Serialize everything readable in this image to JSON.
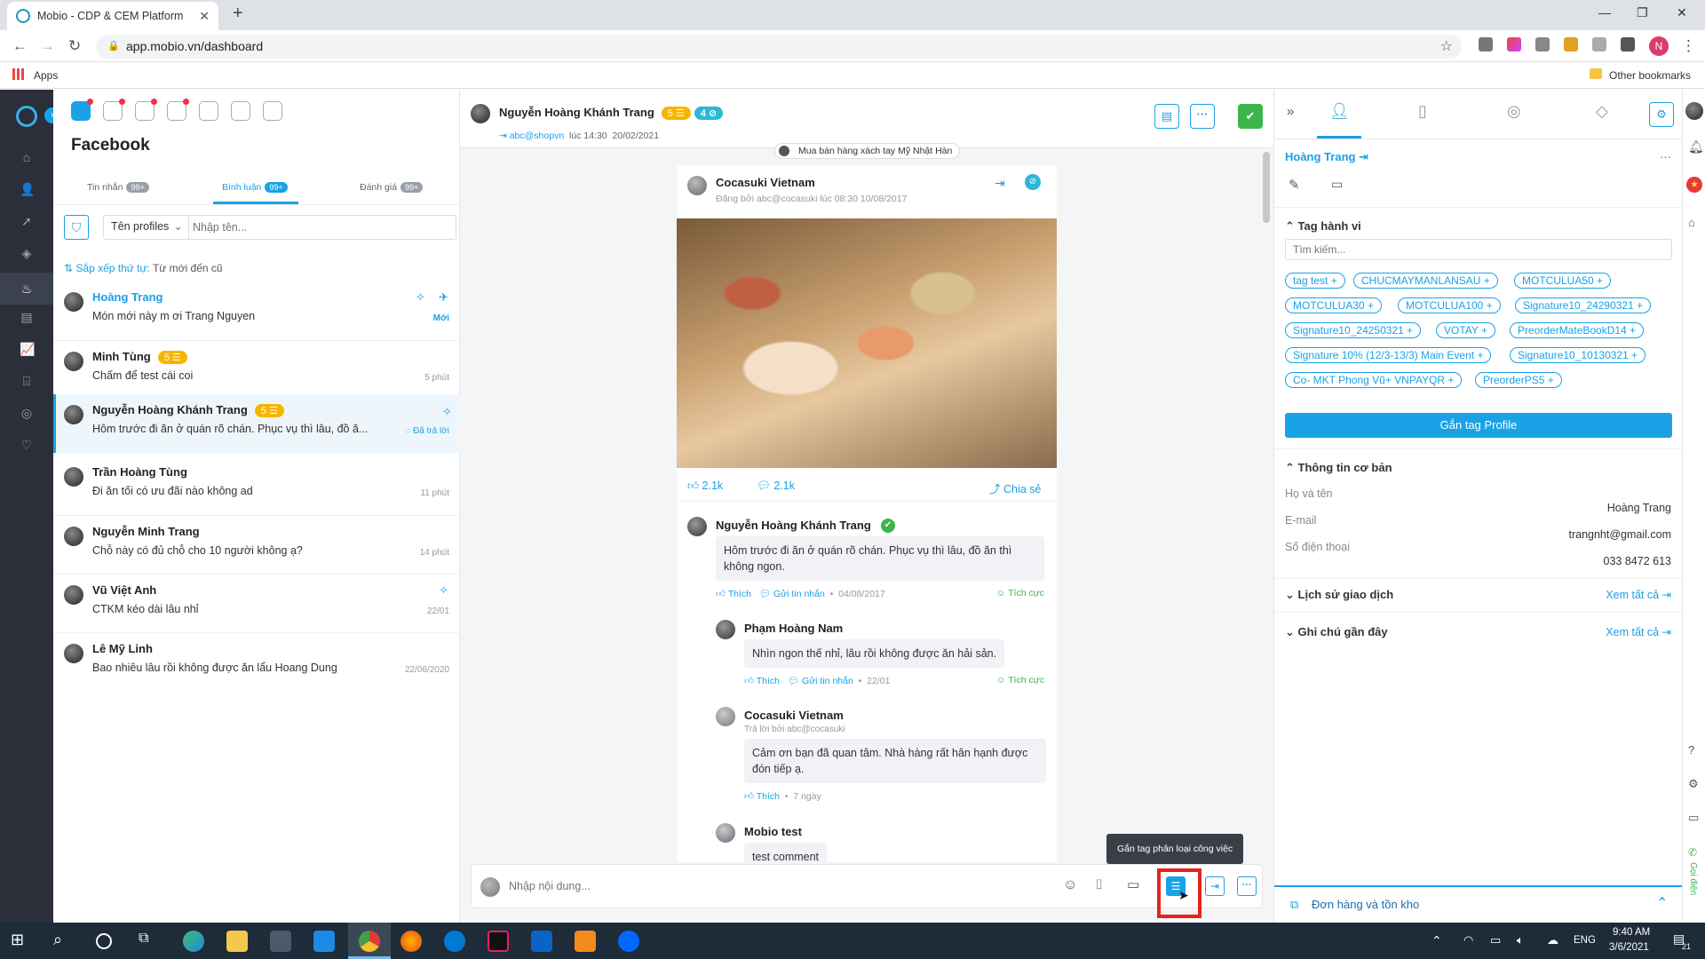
{
  "browser": {
    "tab_title": "Mobio - CDP & CEM Platform",
    "url": "app.mobio.vn/dashboard",
    "apps_label": "Apps",
    "other_bookmarks": "Other bookmarks",
    "profile_initial": "N"
  },
  "inbox": {
    "title": "Facebook",
    "tabs": [
      {
        "label": "Tin nhắn",
        "badge": "99+"
      },
      {
        "label": "Bình luận",
        "badge": "99+"
      },
      {
        "label": "Đánh giá",
        "badge": "99+"
      }
    ],
    "filter_select": "Tên profiles",
    "search_placeholder": "Nhập tên...",
    "sort_label": "Sắp xếp thứ tự:",
    "sort_value": "Từ mới đến cũ",
    "conversations": [
      {
        "name": "Hoàng Trang",
        "message": "Món mới này m ơi Trang Nguyen",
        "time": "Mới"
      },
      {
        "name": "Minh Tùng",
        "badge": "5",
        "message": "Chấm để test cái coi",
        "time": "5 phút"
      },
      {
        "name": "Nguyễn Hoàng Khánh Trang",
        "badge": "5",
        "message": "Hôm trước đi ăn ở quán rõ chán. Phục vụ thì lâu, đồ ă...",
        "time": "Đã trả lời"
      },
      {
        "name": "Trần Hoàng Tùng",
        "message": "Đi ăn tối có ưu đãi nào không ad",
        "time": "11 phút"
      },
      {
        "name": "Nguyễn Minh Trang",
        "message": "Chỗ này có đủ chỗ cho 10 người không ạ?",
        "time": "14 phút"
      },
      {
        "name": "Vũ Việt Anh",
        "message": "CTKM kéo dài lâu nhỉ",
        "time": "22/01"
      },
      {
        "name": "Lê Mỹ Linh",
        "message": "Bao nhiêu lâu rồi không được ăn lẩu Hoang Dung",
        "time": "22/06/2020"
      }
    ]
  },
  "detail": {
    "header_name": "Nguyễn Hoàng Khánh Trang",
    "badge1": "5",
    "badge2": "4",
    "sub_user": "abc@shopvn",
    "sub_time": "lúc 14:30",
    "sub_date": "20/02/2021",
    "page_chip": "Mua bán hàng xách tay Mỹ Nhật Hàn",
    "post": {
      "page_name": "Cocasuki Vietnam",
      "posted_by": "Đăng bởi abc@cocasuki lúc 08:30 10/08/2017",
      "likes": "2.1k",
      "comments": "2.1k",
      "share": "Chia sẻ"
    },
    "comments": [
      {
        "name": "Nguyễn Hoàng Khánh Trang",
        "text": "Hôm trước đi ăn ở quán rõ chán. Phục vụ thì lâu, đồ ăn thì không ngon.",
        "like": "Thích",
        "reply": "Gửi tin nhắn",
        "date": "04/08/2017",
        "sentiment": "Tích cực"
      },
      {
        "name": "Phạm Hoàng Nam",
        "text": "Nhìn ngon thế nhỉ, lâu rồi không được ăn hải sản.",
        "like": "Thích",
        "reply": "Gửi tin nhắn",
        "date": "22/01",
        "sentiment": "Tích cực"
      },
      {
        "name": "Cocasuki Vietnam",
        "sub": "Trả lời bởi abc@cocasuki",
        "text": "Cảm ơn bạn đã quan tâm. Nhà hàng rất hân hạnh được đón tiếp ạ.",
        "like": "Thích",
        "date": "7 ngày"
      },
      {
        "name": "Mobio test",
        "text": "test comment"
      }
    ],
    "composer_placeholder": "Nhập nội dung...",
    "tooltip": "Gắn tag phân loại công việc"
  },
  "profile": {
    "name": "Hoàng Trang",
    "tag_section": "Tag hành vi",
    "tag_search_placeholder": "Tìm kiếm...",
    "tags": [
      "tag test",
      "CHUCMAYMANLANSAU",
      "MOTCULUA50",
      "MOTCULUA30",
      "MOTCULUA100",
      "Signature10_24290321",
      "Signature10_24250321",
      "VOTAY",
      "PreorderMateBookD14",
      "Signature 10% (12/3-13/3) Main Event",
      "Signature10_10130321",
      "Co- MKT Phong Vũ+ VNPAYQR",
      "PreorderPS5"
    ],
    "assign_button": "Gắn tag Profile",
    "basic_section": "Thông tin cơ bản",
    "fields": [
      {
        "label": "Họ và tên",
        "value": "Hoàng Trang"
      },
      {
        "label": "E-mail",
        "value": "trangnht@gmail.com"
      },
      {
        "label": "Số điện thoại",
        "value": "033 8472 613"
      }
    ],
    "history_section": "Lịch sử giao dịch",
    "notes_section": "Ghi chú gần đây",
    "see_all": "Xem tất cả",
    "orders_bar": "Đơn hàng và tồn kho",
    "call_label": "Gọi điện"
  },
  "taskbar": {
    "lang": "ENG",
    "time": "9:40 AM",
    "date": "3/6/2021",
    "notif_count": "21"
  },
  "colors": {
    "accent": "#1aa1e6",
    "badge_yellow": "#f7b500",
    "nav_dark": "#2b2f3a",
    "taskbar": "#1e2b38"
  }
}
